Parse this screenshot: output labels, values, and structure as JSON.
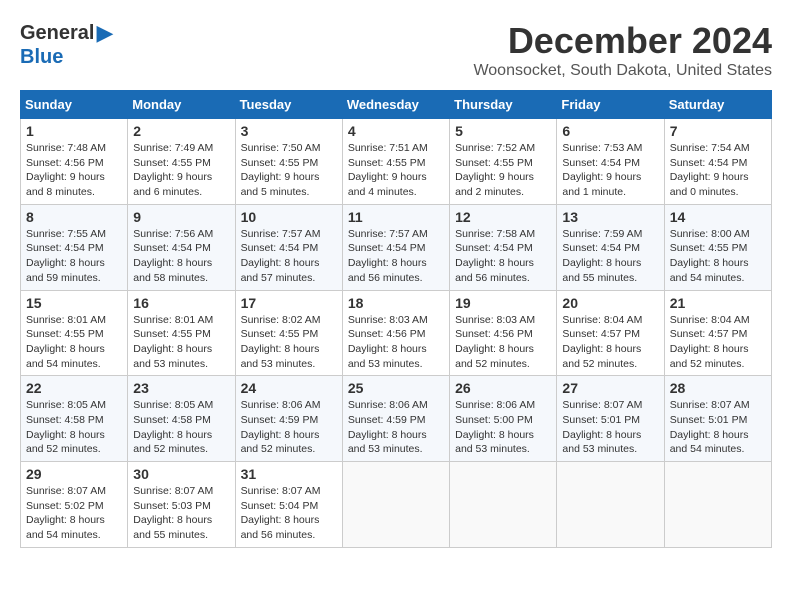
{
  "logo": {
    "general": "General",
    "blue": "Blue"
  },
  "title": "December 2024",
  "location": "Woonsocket, South Dakota, United States",
  "headers": [
    "Sunday",
    "Monday",
    "Tuesday",
    "Wednesday",
    "Thursday",
    "Friday",
    "Saturday"
  ],
  "weeks": [
    [
      {
        "day": "1",
        "sunrise": "7:48 AM",
        "sunset": "4:56 PM",
        "daylight": "9 hours and 8 minutes."
      },
      {
        "day": "2",
        "sunrise": "7:49 AM",
        "sunset": "4:55 PM",
        "daylight": "9 hours and 6 minutes."
      },
      {
        "day": "3",
        "sunrise": "7:50 AM",
        "sunset": "4:55 PM",
        "daylight": "9 hours and 5 minutes."
      },
      {
        "day": "4",
        "sunrise": "7:51 AM",
        "sunset": "4:55 PM",
        "daylight": "9 hours and 4 minutes."
      },
      {
        "day": "5",
        "sunrise": "7:52 AM",
        "sunset": "4:55 PM",
        "daylight": "9 hours and 2 minutes."
      },
      {
        "day": "6",
        "sunrise": "7:53 AM",
        "sunset": "4:54 PM",
        "daylight": "9 hours and 1 minute."
      },
      {
        "day": "7",
        "sunrise": "7:54 AM",
        "sunset": "4:54 PM",
        "daylight": "9 hours and 0 minutes."
      }
    ],
    [
      {
        "day": "8",
        "sunrise": "7:55 AM",
        "sunset": "4:54 PM",
        "daylight": "8 hours and 59 minutes."
      },
      {
        "day": "9",
        "sunrise": "7:56 AM",
        "sunset": "4:54 PM",
        "daylight": "8 hours and 58 minutes."
      },
      {
        "day": "10",
        "sunrise": "7:57 AM",
        "sunset": "4:54 PM",
        "daylight": "8 hours and 57 minutes."
      },
      {
        "day": "11",
        "sunrise": "7:57 AM",
        "sunset": "4:54 PM",
        "daylight": "8 hours and 56 minutes."
      },
      {
        "day": "12",
        "sunrise": "7:58 AM",
        "sunset": "4:54 PM",
        "daylight": "8 hours and 56 minutes."
      },
      {
        "day": "13",
        "sunrise": "7:59 AM",
        "sunset": "4:54 PM",
        "daylight": "8 hours and 55 minutes."
      },
      {
        "day": "14",
        "sunrise": "8:00 AM",
        "sunset": "4:55 PM",
        "daylight": "8 hours and 54 minutes."
      }
    ],
    [
      {
        "day": "15",
        "sunrise": "8:01 AM",
        "sunset": "4:55 PM",
        "daylight": "8 hours and 54 minutes."
      },
      {
        "day": "16",
        "sunrise": "8:01 AM",
        "sunset": "4:55 PM",
        "daylight": "8 hours and 53 minutes."
      },
      {
        "day": "17",
        "sunrise": "8:02 AM",
        "sunset": "4:55 PM",
        "daylight": "8 hours and 53 minutes."
      },
      {
        "day": "18",
        "sunrise": "8:03 AM",
        "sunset": "4:56 PM",
        "daylight": "8 hours and 53 minutes."
      },
      {
        "day": "19",
        "sunrise": "8:03 AM",
        "sunset": "4:56 PM",
        "daylight": "8 hours and 52 minutes."
      },
      {
        "day": "20",
        "sunrise": "8:04 AM",
        "sunset": "4:57 PM",
        "daylight": "8 hours and 52 minutes."
      },
      {
        "day": "21",
        "sunrise": "8:04 AM",
        "sunset": "4:57 PM",
        "daylight": "8 hours and 52 minutes."
      }
    ],
    [
      {
        "day": "22",
        "sunrise": "8:05 AM",
        "sunset": "4:58 PM",
        "daylight": "8 hours and 52 minutes."
      },
      {
        "day": "23",
        "sunrise": "8:05 AM",
        "sunset": "4:58 PM",
        "daylight": "8 hours and 52 minutes."
      },
      {
        "day": "24",
        "sunrise": "8:06 AM",
        "sunset": "4:59 PM",
        "daylight": "8 hours and 52 minutes."
      },
      {
        "day": "25",
        "sunrise": "8:06 AM",
        "sunset": "4:59 PM",
        "daylight": "8 hours and 53 minutes."
      },
      {
        "day": "26",
        "sunrise": "8:06 AM",
        "sunset": "5:00 PM",
        "daylight": "8 hours and 53 minutes."
      },
      {
        "day": "27",
        "sunrise": "8:07 AM",
        "sunset": "5:01 PM",
        "daylight": "8 hours and 53 minutes."
      },
      {
        "day": "28",
        "sunrise": "8:07 AM",
        "sunset": "5:01 PM",
        "daylight": "8 hours and 54 minutes."
      }
    ],
    [
      {
        "day": "29",
        "sunrise": "8:07 AM",
        "sunset": "5:02 PM",
        "daylight": "8 hours and 54 minutes."
      },
      {
        "day": "30",
        "sunrise": "8:07 AM",
        "sunset": "5:03 PM",
        "daylight": "8 hours and 55 minutes."
      },
      {
        "day": "31",
        "sunrise": "8:07 AM",
        "sunset": "5:04 PM",
        "daylight": "8 hours and 56 minutes."
      },
      null,
      null,
      null,
      null
    ]
  ]
}
